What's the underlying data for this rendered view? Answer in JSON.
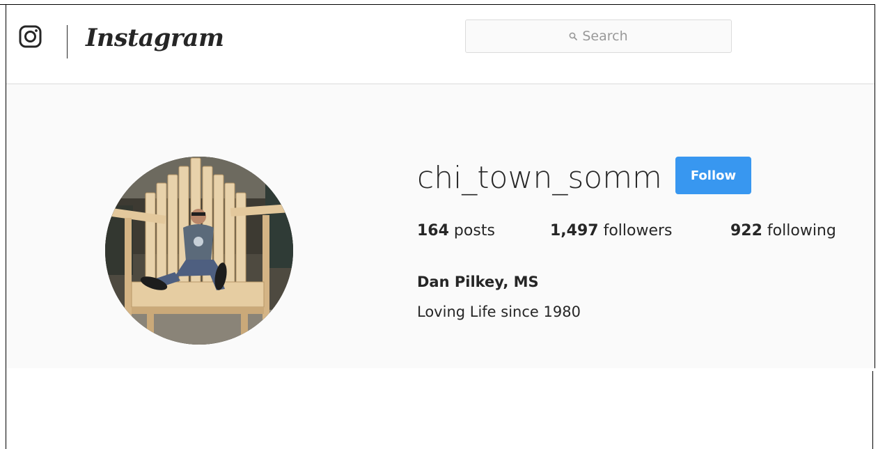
{
  "header": {
    "logo_icon": "instagram-camera-icon",
    "wordmark": "Instagram",
    "search": {
      "placeholder": "Search",
      "icon": "search-icon"
    }
  },
  "profile": {
    "avatar_alt": "profile-photo",
    "username": "chi_town_somm",
    "follow_label": "Follow",
    "stats": {
      "posts_count": "164",
      "posts_label": " posts",
      "followers_count": "1,497",
      "followers_label": " followers",
      "following_count": "922",
      "following_label": " following"
    },
    "full_name": "Dan Pilkey, MS",
    "bio": "Loving Life since 1980"
  },
  "colors": {
    "accent": "#3897f0",
    "text": "#262626",
    "muted": "#999999",
    "background": "#fafafa",
    "border": "#dbdbdb"
  }
}
